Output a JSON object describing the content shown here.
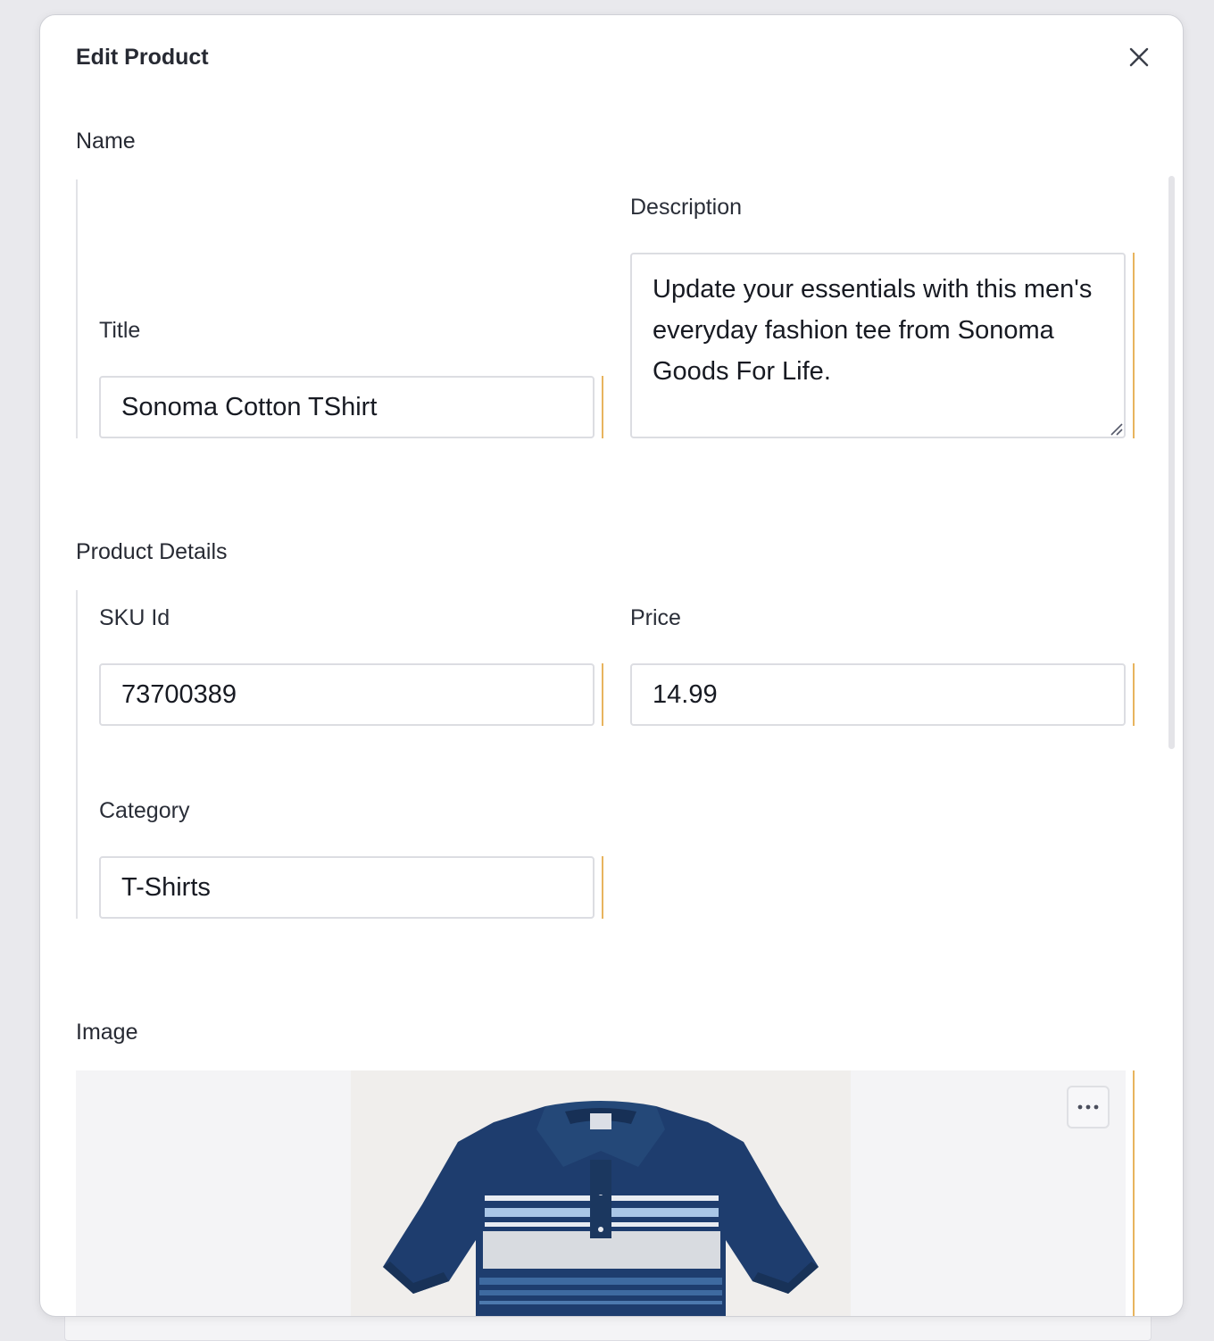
{
  "modal": {
    "title": "Edit Product"
  },
  "name_section": {
    "label": "Name",
    "title_label": "Title",
    "title_value": "Sonoma Cotton TShirt",
    "description_label": "Description",
    "description_value": "Update your essentials with this men's everyday fashion tee from Sonoma Goods For Life."
  },
  "details_section": {
    "label": "Product Details",
    "sku_label": "SKU Id",
    "sku_value": "73700389",
    "price_label": "Price",
    "price_value": "14.99",
    "category_label": "Category",
    "category_value": "T-Shirts"
  },
  "image_section": {
    "label": "Image"
  },
  "colors": {
    "accent": "#e8b45e",
    "shirt_navy": "#1e3d6e"
  },
  "icons": {
    "close": "close-icon",
    "more": "more-horizontal-icon",
    "resize": "resize-grip-icon"
  }
}
